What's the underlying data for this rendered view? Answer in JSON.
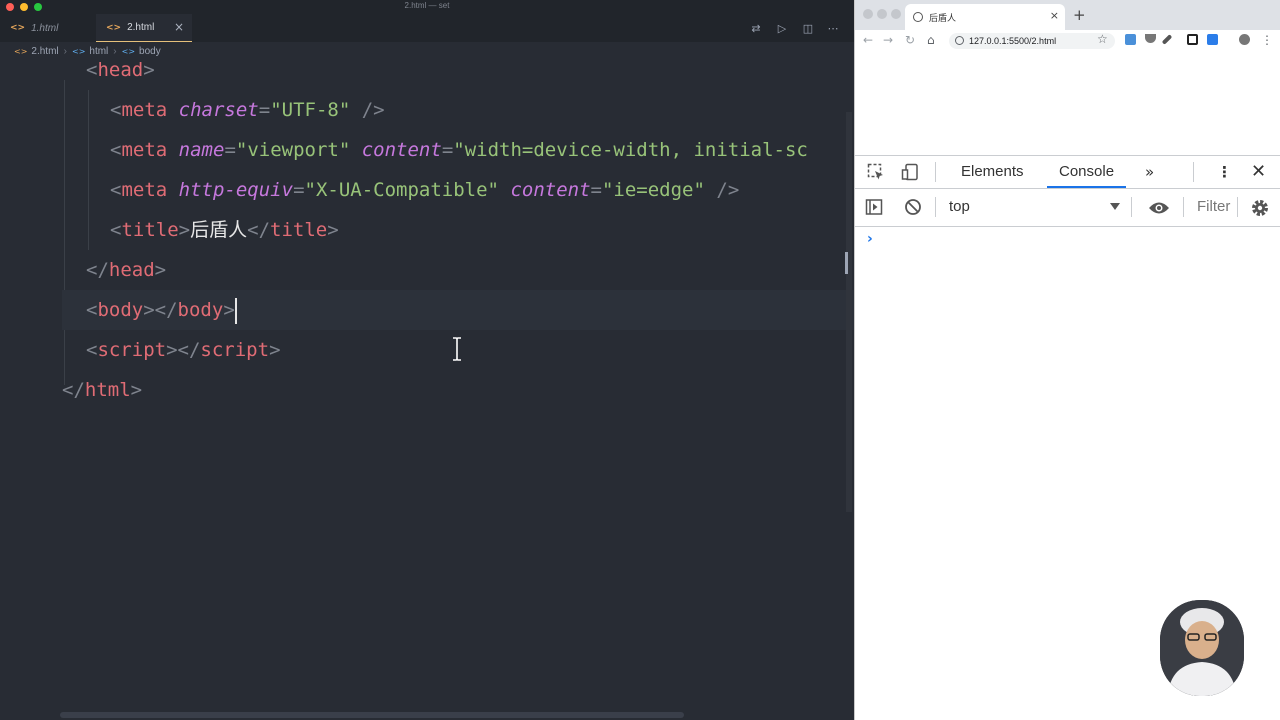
{
  "window": {
    "title": "2.html — set"
  },
  "editor": {
    "tabs": [
      {
        "label": "1.html",
        "active": false
      },
      {
        "label": "2.html",
        "active": true
      }
    ],
    "breadcrumb": [
      "2.html",
      "html",
      "body"
    ],
    "code": {
      "head_open": "head",
      "meta": "meta",
      "attr_charset": "charset",
      "val_charset": "\"UTF-8\"",
      "attr_name": "name",
      "val_viewport": "\"viewport\"",
      "attr_content": "content",
      "val_content_vp": "\"width=device-width, initial-sc",
      "attr_http_equiv": "http-equiv",
      "val_ua": "\"X-UA-Compatible\"",
      "val_edge": "\"ie=edge\"",
      "title_tag": "title",
      "title_text": "后盾人",
      "head_close": "head",
      "body_tag": "body",
      "script_tag": "script",
      "html_tag": "html"
    }
  },
  "browser": {
    "tab_title": "后盾人",
    "url": "127.0.0.1:5500/2.html",
    "devtools": {
      "tabs": [
        "Elements",
        "Console"
      ],
      "active_tab": "Console",
      "context": "top",
      "filter_placeholder": "Filter",
      "prompt": "›"
    }
  },
  "colors": {
    "editor_bg": "#282c34",
    "tag": "#e06c75",
    "attribute": "#c678dd",
    "string": "#98c379",
    "accent": "#1a73e8"
  }
}
